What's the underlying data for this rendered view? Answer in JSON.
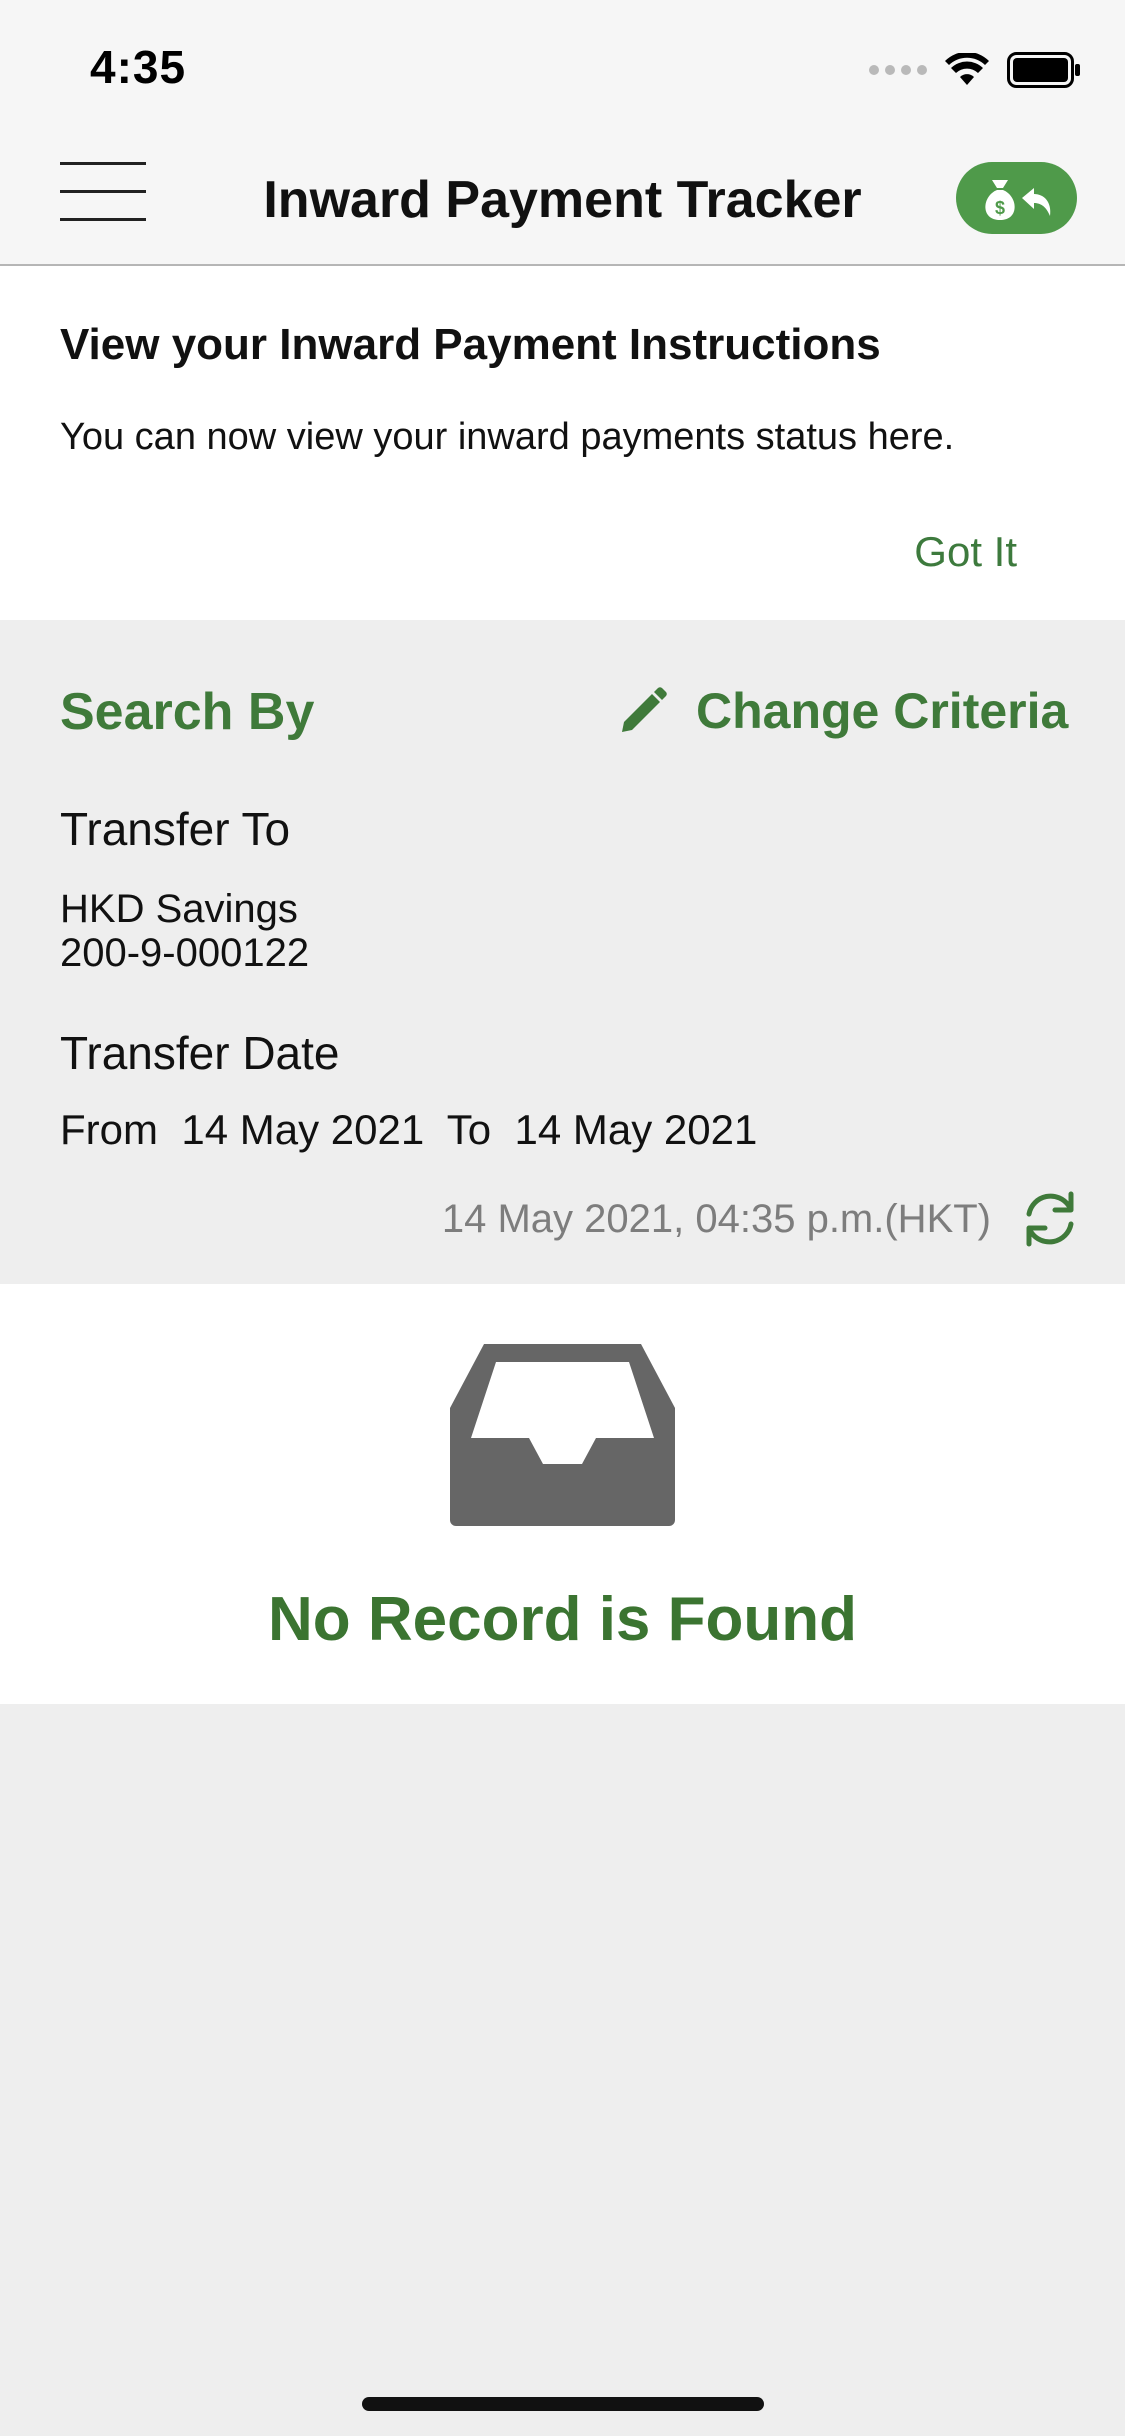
{
  "status_bar": {
    "time": "4:35"
  },
  "nav": {
    "title": "Inward Payment Tracker",
    "menu_icon": "hamburger-menu-icon",
    "action_icon": "money-bag-return-icon",
    "accent_color": "#4f9a4a"
  },
  "tip": {
    "title": "View your Inward Payment Instructions",
    "body": "You can now view your inward payments status here.",
    "dismiss_label": "Got It"
  },
  "search": {
    "heading": "Search By",
    "change_criteria_label": "Change Criteria",
    "transfer_to_label": "Transfer To",
    "account_name": "HKD Savings",
    "account_number": "200-9-000122",
    "transfer_date_label": "Transfer Date",
    "from_label": "From",
    "from_date": "14 May 2021",
    "to_label": "To",
    "to_date": "14 May 2021",
    "last_updated": "14 May 2021, 04:35 p.m.(HKT)"
  },
  "results": {
    "empty_message": "No Record is Found",
    "empty_icon": "inbox-tray-icon"
  },
  "colors": {
    "brand_green": "#3f7a3a",
    "background": "#eeeeee"
  }
}
